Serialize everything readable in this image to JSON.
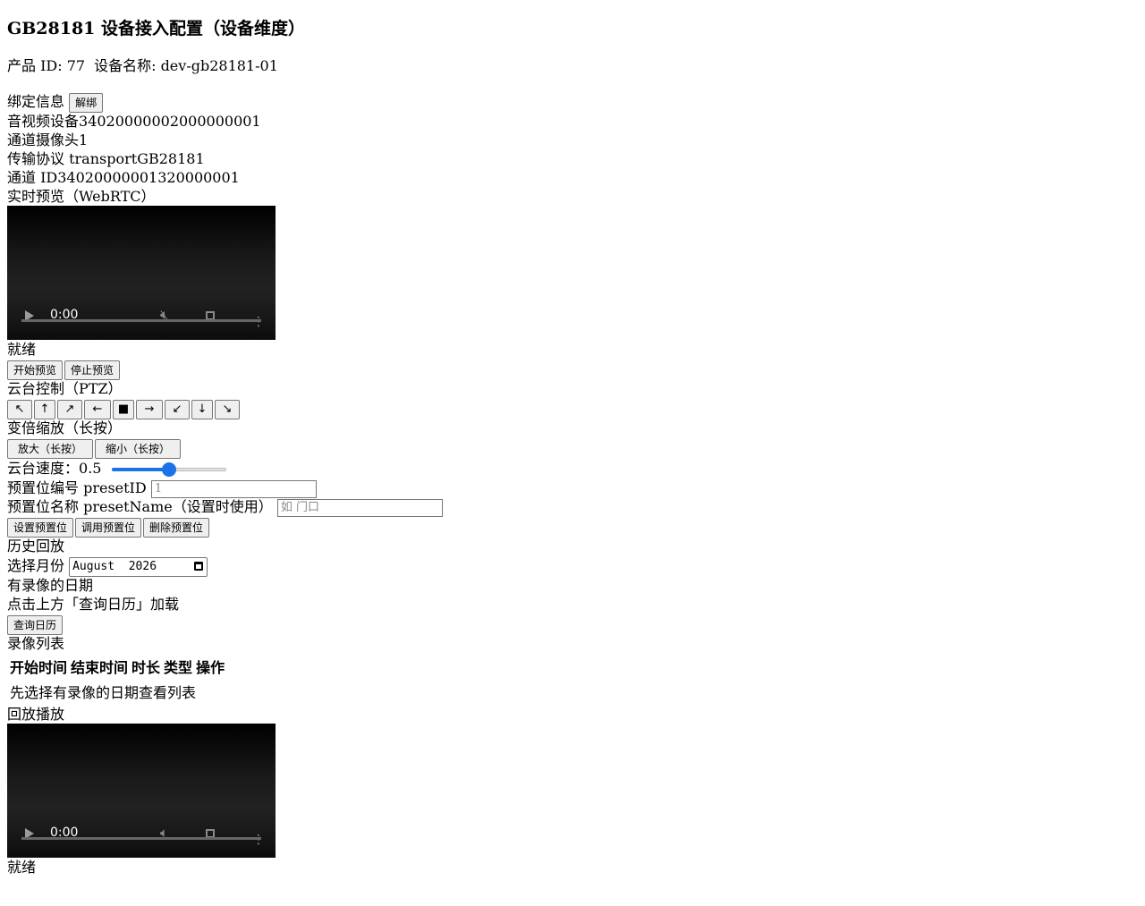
{
  "header": {
    "title": "GB28181 设备接入配置（设备维度）",
    "product_id_label": "产品 ID: ",
    "product_id": "77",
    "device_name_label": "设备名称: ",
    "device_name": "dev-gb28181-01"
  },
  "binding": {
    "label": "绑定信息",
    "unbind_label": "解绑",
    "av_device_label": "音视频设备",
    "av_device_value": "34020000002000000001",
    "channel_label": "通道",
    "channel_value": "摄像头1",
    "transport_label": "传输协议 transport",
    "transport_value": "GB28181",
    "channel_id_label": "通道 ID",
    "channel_id_value": "34020000001320000001"
  },
  "live": {
    "title": "实时预览（WebRTC）",
    "video_time": "0:00",
    "status": "就绪",
    "start_label": "开始预览",
    "stop_label": "停止预览"
  },
  "ptz": {
    "title": "云台控制（PTZ）",
    "buttons": [
      "↖",
      "↑",
      "↗",
      "←",
      "■",
      "→",
      "↙",
      "↓",
      "↘"
    ],
    "zoom_title": "变倍缩放（长按）",
    "zoom_in_label": "放大（长按）",
    "zoom_out_label": "缩小（长按）",
    "speed_label": "云台速度：",
    "speed_value": "0.5",
    "speed_fraction": 0.5,
    "preset_id_label": "预置位编号 presetID",
    "preset_id_placeholder": "1",
    "preset_name_label": "预置位名称 presetName（设置时使用）",
    "preset_name_placeholder": "如 门口",
    "set_preset_label": "设置预置位",
    "call_preset_label": "调用预置位",
    "delete_preset_label": "删除预置位"
  },
  "history": {
    "title": "历史回放",
    "month_label": "选择月份",
    "month_value": "August  2026",
    "dates_title": "有录像的日期",
    "dates_hint": "点击上方「查询日历」加载",
    "query_label": "查询日历",
    "list_title": "录像列表",
    "columns": [
      "开始时间",
      "结束时间",
      "时长",
      "类型",
      "操作"
    ],
    "empty_text": "先选择有录像的日期查看列表",
    "playback_title": "回放播放",
    "playback_time": "0:00",
    "playback_status": "就绪"
  }
}
